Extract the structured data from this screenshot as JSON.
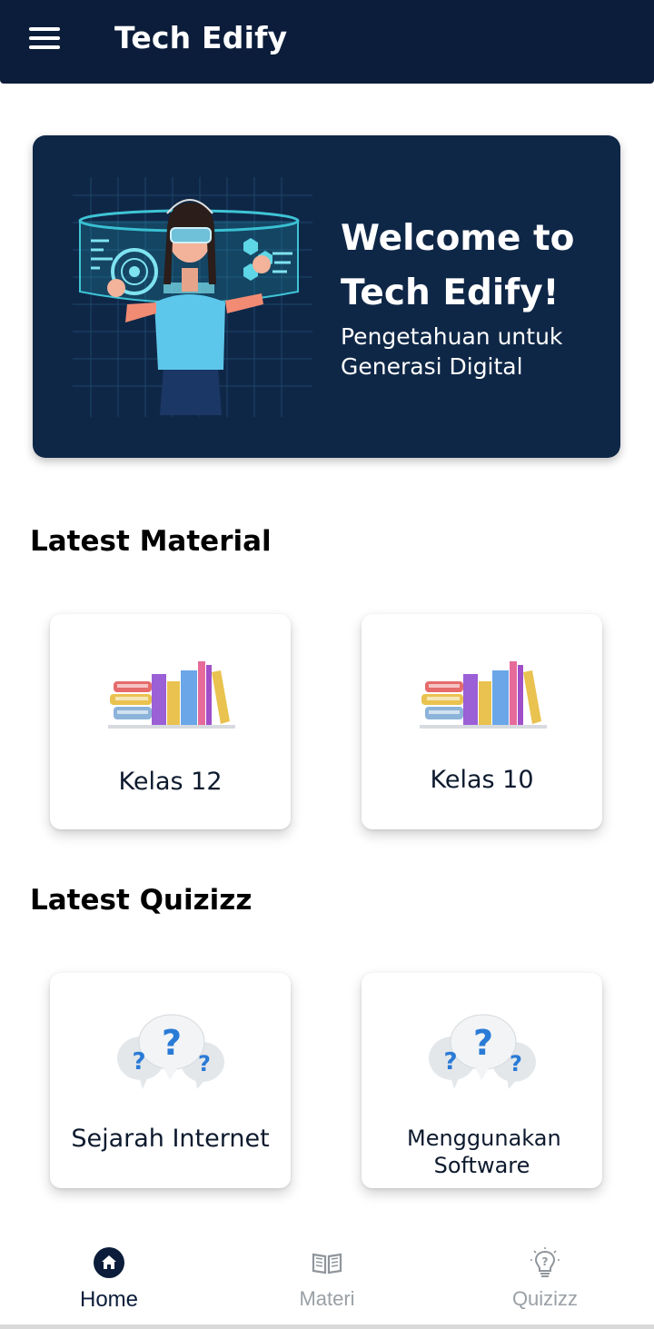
{
  "app": {
    "title": "Tech Edify",
    "colors": {
      "primary": "#0b1d3a",
      "banner": "#0f2747",
      "inactive": "#9aa0a6"
    }
  },
  "banner": {
    "heading": "Welcome to Tech Edify!",
    "subheading": "Pengetahuan untuk Generasi Digital"
  },
  "material": {
    "title": "Latest Material",
    "items": [
      {
        "label": "Kelas 12",
        "icon": "books-icon"
      },
      {
        "label": "Kelas 10",
        "icon": "books-icon"
      }
    ]
  },
  "quiz": {
    "title": "Latest Quizizz",
    "items": [
      {
        "label": "Sejarah Internet",
        "icon": "question-bubbles-icon"
      },
      {
        "label": "Menggunakan Software",
        "icon": "question-bubbles-icon"
      }
    ]
  },
  "nav": {
    "items": [
      {
        "label": "Home",
        "icon": "home-icon",
        "active": true
      },
      {
        "label": "Materi",
        "icon": "book-icon",
        "active": false
      },
      {
        "label": "Quizizz",
        "icon": "lightbulb-icon",
        "active": false
      }
    ]
  }
}
